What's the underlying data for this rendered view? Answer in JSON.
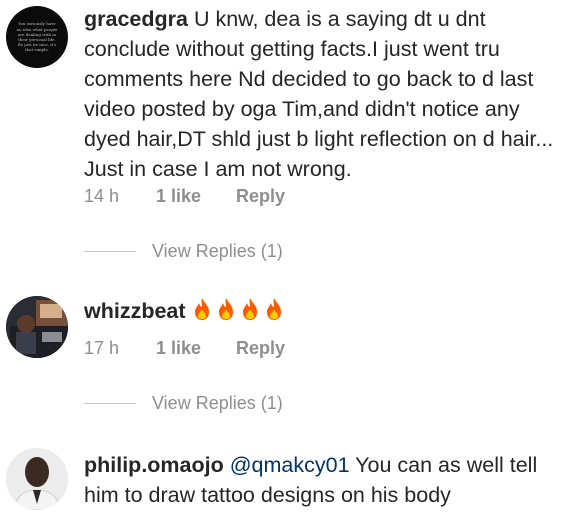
{
  "comments": [
    {
      "username": "gracedgra",
      "text": " U knw, dea is a saying dt u dnt conclude without getting facts.I just went tru comments here Nd decided to go back to d last video posted by oga Tim,and didn't notice any dyed hair,DT shld just b light reflection  on d hair... Just in case I am not wrong.",
      "time": "14 h",
      "likes": "1 like",
      "reply": "Reply",
      "view_replies": "View Replies (1)",
      "avatar_text": "You seriously have no idea what people are dealing with in their personal life. Be just be nice, it's that simple."
    },
    {
      "username": "whizzbeat",
      "emoji_count": 4,
      "emoji": "fire",
      "time": "17 h",
      "likes": "1 like",
      "reply": "Reply",
      "view_replies": "View Replies (1)"
    },
    {
      "username": "philip.omaojo",
      "mention": "@qmakcy01",
      "text": " You can as well tell him to draw tattoo designs on his body"
    }
  ],
  "colors": {
    "text": "#262626",
    "meta": "#8e8e8e",
    "mention": "#003569",
    "fire_outer": "#ff5a00",
    "fire_inner": "#ffcc00"
  },
  "icons": [
    "fire-icon"
  ]
}
